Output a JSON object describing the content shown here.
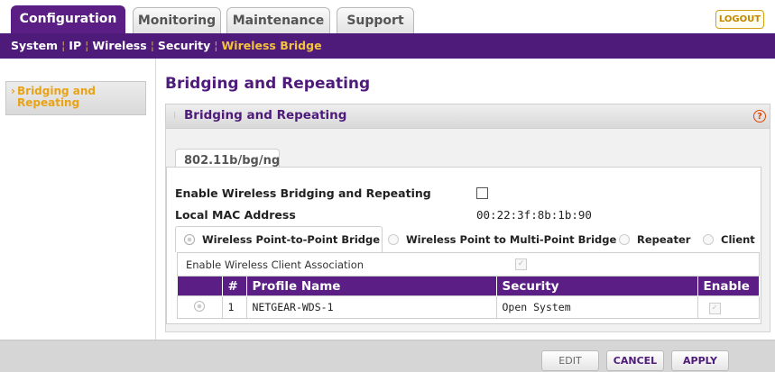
{
  "top_tabs": [
    "Configuration",
    "Monitoring",
    "Maintenance",
    "Support"
  ],
  "logout_label": "LOGOUT",
  "subnav": [
    "System",
    "IP",
    "Wireless",
    "Security",
    "Wireless Bridge"
  ],
  "sidebar": {
    "item_label": "Bridging and Repeating"
  },
  "page_heading": "Bridging and Repeating",
  "panel": {
    "title": "Bridging and Repeating",
    "help_glyph": "?"
  },
  "radio_tab_label": "802.11b/bg/ng",
  "enable_label": "Enable Wireless Bridging and Repeating",
  "enable_checked": false,
  "mac_label": "Local MAC Address",
  "mac_value": "00:22:3f:8b:1b:90",
  "modes": [
    "Wireless Point-to-Point Bridge",
    "Wireless Point to Multi-Point Bridge",
    "Repeater",
    "Client"
  ],
  "selected_mode": "Wireless Point-to-Point Bridge",
  "client_assoc_label": "Enable Wireless Client Association",
  "client_assoc_checked": true,
  "table": {
    "headers": [
      "",
      "#",
      "Profile Name",
      "Security",
      "Enable"
    ],
    "rows": [
      {
        "num": "1",
        "profile": "NETGEAR-WDS-1",
        "security": "Open System",
        "enabled": true
      }
    ]
  },
  "buttons": {
    "edit": "EDIT",
    "cancel": "CANCEL",
    "apply": "APPLY"
  },
  "colors": {
    "brand_purple": "#4e1b7b",
    "accent_orange": "#e8a317"
  }
}
